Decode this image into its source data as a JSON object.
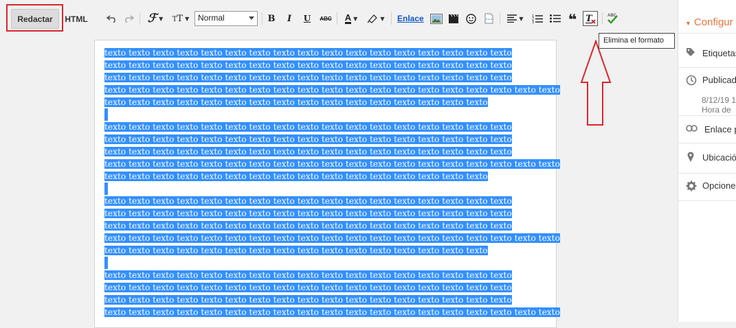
{
  "mode_tabs": {
    "compose": "Redactar",
    "html": "HTML"
  },
  "toolbar": {
    "font_size_value": "Normal",
    "link_label": "Enlace",
    "bold": "B",
    "italic": "I",
    "underline": "U",
    "strike": "ABC",
    "spell": "ABC",
    "tooltip": "Elimina el formato"
  },
  "editor": {
    "paragraphs": [
      [
        "texto texto texto texto texto texto texto texto texto texto texto texto texto texto texto texto texto",
        "texto texto texto texto texto texto texto texto texto texto texto texto texto texto texto texto texto",
        "texto texto texto texto texto texto texto texto texto texto texto texto texto texto texto texto texto",
        "texto texto texto texto texto texto texto texto texto texto texto texto texto texto texto texto texto texto texto",
        "texto texto texto texto texto texto texto texto texto texto texto texto texto texto texto texto"
      ],
      [
        "texto texto texto texto texto texto texto texto texto texto texto texto texto texto texto texto texto",
        "texto texto texto texto texto texto texto texto texto texto texto texto texto texto texto texto texto",
        "texto texto texto texto texto texto texto texto texto texto texto texto texto texto texto texto texto",
        "texto texto texto texto texto texto texto texto texto texto texto texto texto texto texto texto texto texto texto",
        "texto texto texto texto texto texto texto texto texto texto texto texto texto texto texto texto"
      ],
      [
        "texto texto texto texto texto texto texto texto texto texto texto texto texto texto texto texto texto",
        "texto texto texto texto texto texto texto texto texto texto texto texto texto texto texto texto texto",
        "texto texto texto texto texto texto texto texto texto texto texto texto texto texto texto texto texto",
        "texto texto texto texto texto texto texto texto texto texto texto texto texto texto texto texto texto texto texto",
        "texto texto texto texto texto texto texto texto texto texto texto texto texto texto texto texto"
      ],
      [
        "texto texto texto texto texto texto texto texto texto texto texto texto texto texto texto texto texto",
        "texto texto texto texto texto texto texto texto texto texto texto texto texto texto texto texto texto",
        "texto texto texto texto texto texto texto texto texto texto texto texto texto texto texto texto texto",
        "texto texto texto texto texto texto texto texto texto texto texto texto texto texto texto texto texto texto texto"
      ]
    ]
  },
  "sidebar": {
    "header": "Configur",
    "labels": "Etiquetas",
    "published": "Publicad",
    "published_date": "8/12/19 1",
    "published_time": "Hora de",
    "permalink": "Enlace p",
    "location": "Ubicació",
    "options": "Opciones"
  },
  "colors": {
    "selection": "#3390ff",
    "accent": "#e8743b",
    "highlight_red": "#d9262c"
  }
}
